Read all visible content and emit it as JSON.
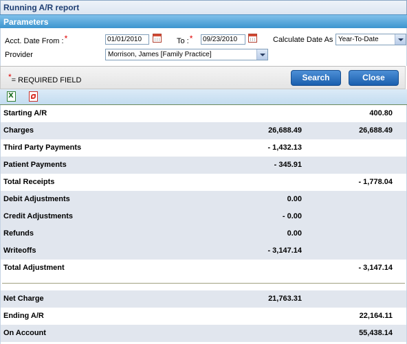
{
  "window": {
    "title": "Running A/R report"
  },
  "parameters": {
    "header": "Parameters",
    "acct_date_from_label": "Acct. Date From :",
    "required_mark": "*",
    "acct_date_from_value": "01/01/2010",
    "to_label": "To :",
    "to_value": "09/23/2010",
    "calculate_label": "Calculate Date As",
    "calculate_value": "Year-To-Date",
    "provider_label": "Provider",
    "provider_value": "Morrison, James [Family Practice]"
  },
  "required_bar": {
    "note_mark": "*",
    "note_text": "= REQUIRED FIELD",
    "search_label": "Search",
    "close_label": "Close"
  },
  "toolbar": {
    "excel_icon": "excel-export-icon",
    "pdf_icon": "pdf-export-icon"
  },
  "report": {
    "rows": [
      {
        "label": "Starting A/R",
        "col1": "",
        "col2": "400.80"
      },
      {
        "label": "Charges",
        "col1": "26,688.49",
        "col2": "26,688.49"
      },
      {
        "label": "Third Party Payments",
        "col1": "- 1,432.13",
        "col2": ""
      },
      {
        "label": "Patient Payments",
        "col1": "- 345.91",
        "col2": ""
      },
      {
        "label": "Total Receipts",
        "col1": "",
        "col2": "- 1,778.04"
      },
      {
        "label": "Debit Adjustments",
        "col1": "0.00",
        "col2": ""
      },
      {
        "label": "Credit Adjustments",
        "col1": "- 0.00",
        "col2": ""
      },
      {
        "label": "Refunds",
        "col1": "0.00",
        "col2": ""
      },
      {
        "label": "Writeoffs",
        "col1": "- 3,147.14",
        "col2": ""
      },
      {
        "label": "Total Adjustment",
        "col1": "",
        "col2": "- 3,147.14"
      },
      {
        "label": "Net Charge",
        "col1": "21,763.31",
        "col2": ""
      },
      {
        "label": "Ending A/R",
        "col1": "",
        "col2": "22,164.11"
      },
      {
        "label": "On Account",
        "col1": "",
        "col2": "55,438.14"
      }
    ]
  }
}
